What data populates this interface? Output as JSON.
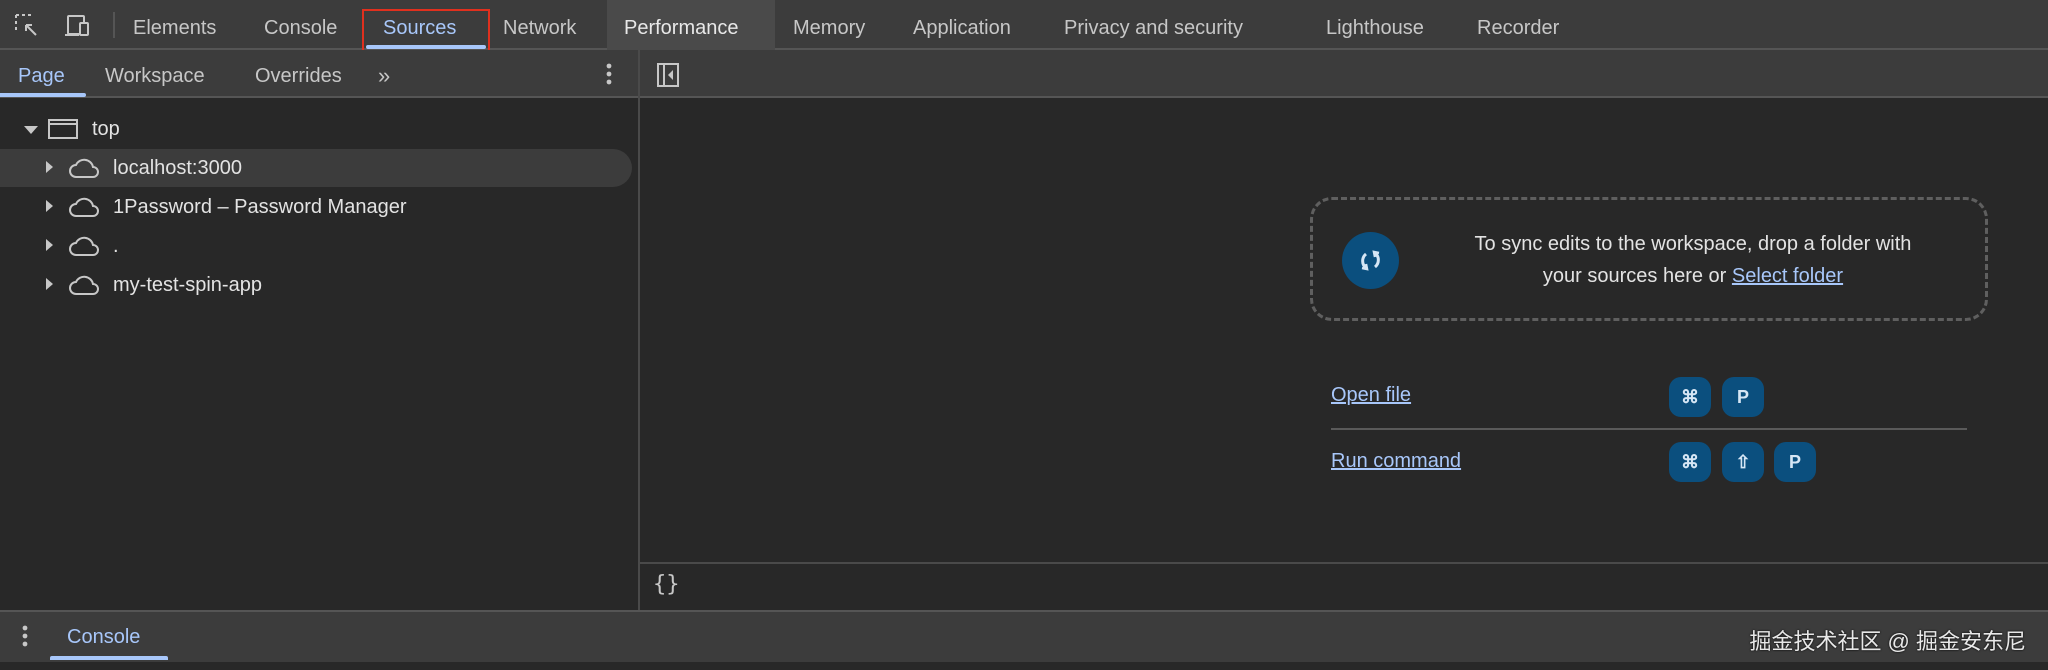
{
  "toolbar": {
    "tabs": [
      "Elements",
      "Console",
      "Sources",
      "Network",
      "Performance",
      "Memory",
      "Application",
      "Privacy and security",
      "Lighthouse",
      "Recorder"
    ],
    "active": "Sources"
  },
  "navigator": {
    "tabs": [
      "Page",
      "Workspace",
      "Overrides"
    ],
    "active": "Page"
  },
  "tree": {
    "root": "top",
    "items": [
      "localhost:3000",
      "1Password – Password Manager",
      ".",
      "my-test-spin-app"
    ]
  },
  "workspace": {
    "message": "To sync edits to the workspace, drop a folder with",
    "message2": "your sources here or",
    "select_folder": "Select folder"
  },
  "shortcuts": [
    {
      "label": "Open file",
      "keys": [
        "⌘",
        "P"
      ]
    },
    {
      "label": "Run command",
      "keys": [
        "⌘",
        "⇧",
        "P"
      ]
    }
  ],
  "drawer": {
    "tab": "Console"
  },
  "watermark": "掘金技术社区 @ 掘金安东尼",
  "colors": {
    "accent": "#a8c7fa",
    "key_bg": "#0b4f7e"
  }
}
